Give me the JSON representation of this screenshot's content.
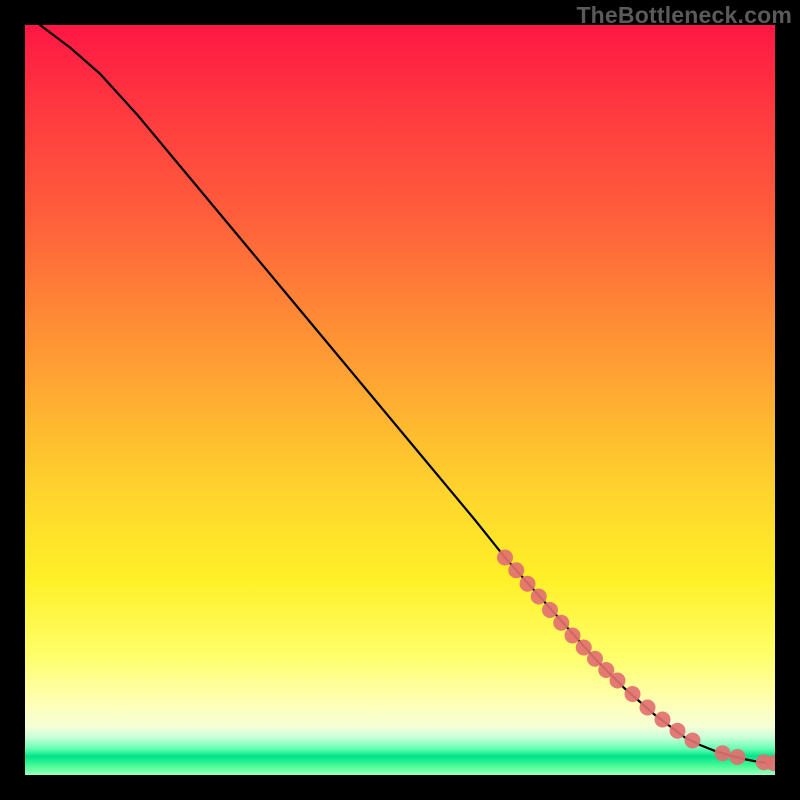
{
  "watermark": "TheBottleneck.com",
  "chart_data": {
    "type": "line",
    "title": "",
    "xlabel": "",
    "ylabel": "",
    "xlim": [
      0,
      100
    ],
    "ylim": [
      0,
      100
    ],
    "grid": false,
    "legend": false,
    "series": [
      {
        "name": "curve",
        "style": "line",
        "color": "#000000",
        "x": [
          2,
          6,
          10,
          15,
          20,
          25,
          30,
          35,
          40,
          45,
          50,
          55,
          60,
          64,
          68,
          72,
          76,
          80,
          84,
          88,
          90,
          92,
          94,
          96,
          98,
          99.5
        ],
        "y": [
          100,
          97,
          93.5,
          88,
          82,
          76,
          70,
          64,
          58,
          52,
          46,
          40,
          34,
          29,
          24.5,
          20,
          15.5,
          11.5,
          8,
          5,
          4,
          3.2,
          2.6,
          2.1,
          1.7,
          1.6
        ]
      },
      {
        "name": "markers",
        "style": "scatter",
        "color": "#e27070",
        "x": [
          64,
          65.5,
          67,
          68.5,
          70,
          71.5,
          73,
          74.5,
          76,
          77.5,
          79,
          81,
          83,
          85,
          87,
          89,
          93,
          95,
          98.5,
          99.8
        ],
        "y": [
          29,
          27.3,
          25.5,
          23.8,
          22,
          20.3,
          18.6,
          17,
          15.5,
          14,
          12.6,
          10.8,
          9,
          7.4,
          5.9,
          4.6,
          2.9,
          2.4,
          1.7,
          1.6
        ]
      }
    ]
  }
}
